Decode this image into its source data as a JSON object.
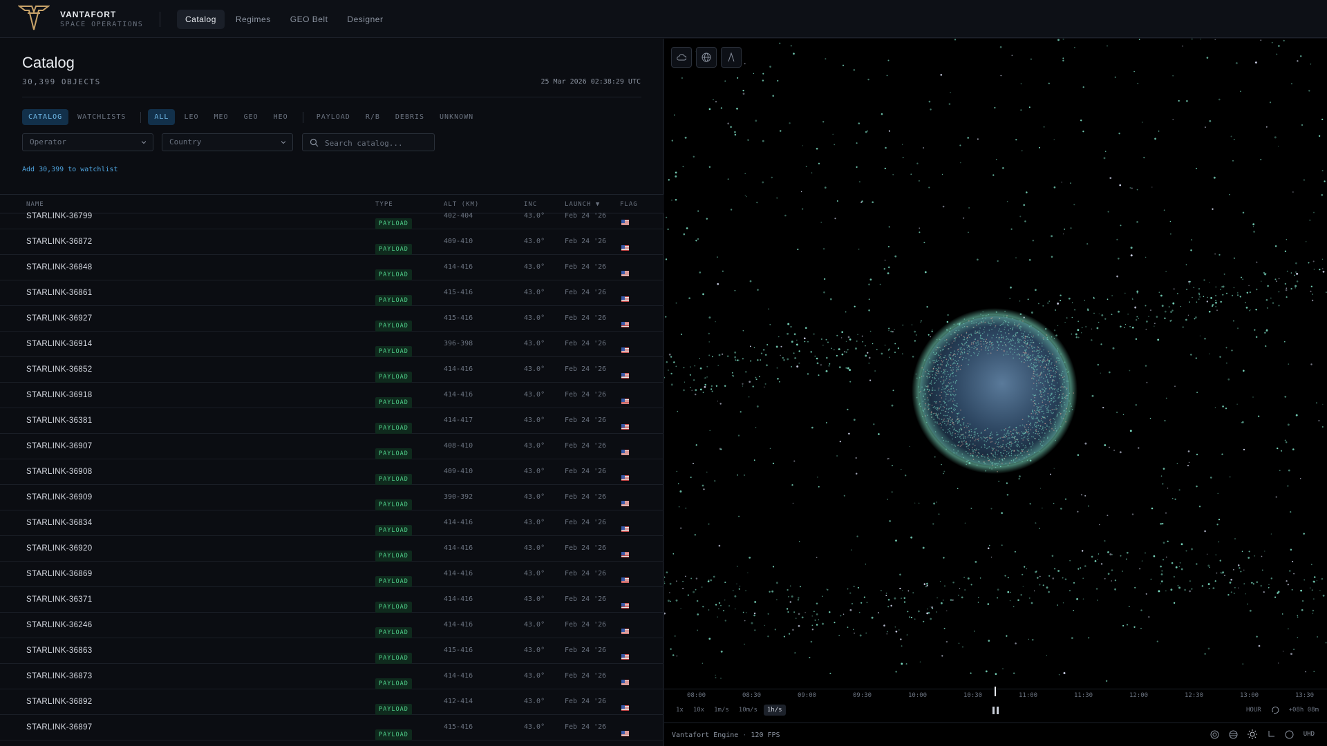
{
  "brand": {
    "name": "VANTAFORT",
    "subtitle": "SPACE OPERATIONS"
  },
  "nav": [
    {
      "label": "Catalog",
      "active": true
    },
    {
      "label": "Regimes",
      "active": false
    },
    {
      "label": "GEO Belt",
      "active": false
    },
    {
      "label": "Designer",
      "active": false
    }
  ],
  "catalog": {
    "title": "Catalog",
    "object_count": "30,399 OBJECTS",
    "timestamp": "25 Mar 2026 02:38:29 UTC",
    "view_tabs": [
      {
        "label": "CATALOG",
        "active": true
      },
      {
        "label": "WATCHLISTS",
        "active": false
      }
    ],
    "regime_filters": [
      {
        "label": "ALL",
        "active": true
      },
      {
        "label": "LEO",
        "active": false
      },
      {
        "label": "MEO",
        "active": false
      },
      {
        "label": "GEO",
        "active": false
      },
      {
        "label": "HEO",
        "active": false
      }
    ],
    "type_filters": [
      {
        "label": "PAYLOAD"
      },
      {
        "label": "R/B"
      },
      {
        "label": "DEBRIS"
      },
      {
        "label": "UNKNOWN"
      }
    ],
    "operator_select": "Operator",
    "country_select": "Country",
    "search_placeholder": "Search catalog...",
    "watchlist_link": "Add 30,399 to watchlist",
    "columns": {
      "name": "NAME",
      "type": "TYPE",
      "alt": "ALT (KM)",
      "inc": "INC",
      "launch": "LAUNCH ▼",
      "flag": "FLAG"
    },
    "rows": [
      {
        "name": "STARLINK-36799",
        "type": "PAYLOAD",
        "alt": "402-404",
        "inc": "43.0°",
        "launch": "Feb 24 '26"
      },
      {
        "name": "STARLINK-36872",
        "type": "PAYLOAD",
        "alt": "409-410",
        "inc": "43.0°",
        "launch": "Feb 24 '26"
      },
      {
        "name": "STARLINK-36848",
        "type": "PAYLOAD",
        "alt": "414-416",
        "inc": "43.0°",
        "launch": "Feb 24 '26"
      },
      {
        "name": "STARLINK-36861",
        "type": "PAYLOAD",
        "alt": "415-416",
        "inc": "43.0°",
        "launch": "Feb 24 '26"
      },
      {
        "name": "STARLINK-36927",
        "type": "PAYLOAD",
        "alt": "415-416",
        "inc": "43.0°",
        "launch": "Feb 24 '26"
      },
      {
        "name": "STARLINK-36914",
        "type": "PAYLOAD",
        "alt": "396-398",
        "inc": "43.0°",
        "launch": "Feb 24 '26"
      },
      {
        "name": "STARLINK-36852",
        "type": "PAYLOAD",
        "alt": "414-416",
        "inc": "43.0°",
        "launch": "Feb 24 '26"
      },
      {
        "name": "STARLINK-36918",
        "type": "PAYLOAD",
        "alt": "414-416",
        "inc": "43.0°",
        "launch": "Feb 24 '26"
      },
      {
        "name": "STARLINK-36381",
        "type": "PAYLOAD",
        "alt": "414-417",
        "inc": "43.0°",
        "launch": "Feb 24 '26"
      },
      {
        "name": "STARLINK-36907",
        "type": "PAYLOAD",
        "alt": "408-410",
        "inc": "43.0°",
        "launch": "Feb 24 '26"
      },
      {
        "name": "STARLINK-36908",
        "type": "PAYLOAD",
        "alt": "409-410",
        "inc": "43.0°",
        "launch": "Feb 24 '26"
      },
      {
        "name": "STARLINK-36909",
        "type": "PAYLOAD",
        "alt": "390-392",
        "inc": "43.0°",
        "launch": "Feb 24 '26"
      },
      {
        "name": "STARLINK-36834",
        "type": "PAYLOAD",
        "alt": "414-416",
        "inc": "43.0°",
        "launch": "Feb 24 '26"
      },
      {
        "name": "STARLINK-36920",
        "type": "PAYLOAD",
        "alt": "414-416",
        "inc": "43.0°",
        "launch": "Feb 24 '26"
      },
      {
        "name": "STARLINK-36869",
        "type": "PAYLOAD",
        "alt": "414-416",
        "inc": "43.0°",
        "launch": "Feb 24 '26"
      },
      {
        "name": "STARLINK-36371",
        "type": "PAYLOAD",
        "alt": "414-416",
        "inc": "43.0°",
        "launch": "Feb 24 '26"
      },
      {
        "name": "STARLINK-36246",
        "type": "PAYLOAD",
        "alt": "414-416",
        "inc": "43.0°",
        "launch": "Feb 24 '26"
      },
      {
        "name": "STARLINK-36863",
        "type": "PAYLOAD",
        "alt": "415-416",
        "inc": "43.0°",
        "launch": "Feb 24 '26"
      },
      {
        "name": "STARLINK-36873",
        "type": "PAYLOAD",
        "alt": "414-416",
        "inc": "43.0°",
        "launch": "Feb 24 '26"
      },
      {
        "name": "STARLINK-36892",
        "type": "PAYLOAD",
        "alt": "412-414",
        "inc": "43.0°",
        "launch": "Feb 24 '26"
      },
      {
        "name": "STARLINK-36897",
        "type": "PAYLOAD",
        "alt": "415-416",
        "inc": "43.0°",
        "launch": "Feb 24 '26"
      }
    ]
  },
  "viewer": {
    "tools": [
      "cloud-icon",
      "globe-icon",
      "compass-icon"
    ],
    "timeline_ticks": [
      "08:00",
      "08:30",
      "09:00",
      "09:30",
      "10:00",
      "10:30",
      "11:00",
      "11:30",
      "12:00",
      "12:30",
      "13:00",
      "13:30"
    ],
    "speeds": [
      {
        "label": "1x",
        "active": false
      },
      {
        "label": "10x",
        "active": false
      },
      {
        "label": "1m/s",
        "active": false
      },
      {
        "label": "10m/s",
        "active": false
      },
      {
        "label": "1h/s",
        "active": true
      }
    ],
    "scale_label": "HOUR",
    "offset_label": "+08h 08m",
    "engine_name": "Vantafort Engine",
    "fps": "120 FPS",
    "quality": "UHD"
  },
  "colors": {
    "accent": "#4ea3dd",
    "payload_badge": "#4fd08a",
    "orbit_dots": "#7fe3c8"
  }
}
